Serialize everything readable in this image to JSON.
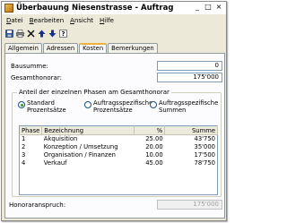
{
  "window": {
    "title": "Überbauung Niesenstrasse - Auftrag"
  },
  "titlebar_buttons": {
    "minimize": "_",
    "maximize": "□",
    "close": "×"
  },
  "menu": {
    "items": [
      {
        "underline": "D",
        "rest": "atei"
      },
      {
        "underline": "B",
        "rest": "earbeiten"
      },
      {
        "underline": "A",
        "rest": "nsicht"
      },
      {
        "underline": "H",
        "rest": "ilfe"
      }
    ]
  },
  "toolbar": {
    "icons": [
      "save-icon",
      "print-icon",
      "delete-icon",
      "arrow-up-icon",
      "arrow-down-icon",
      "help-icon"
    ]
  },
  "tabs": [
    "Allgemein",
    "Adressen",
    "Kosten",
    "Bemerkungen"
  ],
  "active_tab": "Kosten",
  "costs": {
    "bausumme_label": "Bausumme:",
    "bausumme_value": "0",
    "gesamthonorar_label": "Gesamthonorar:",
    "gesamthonorar_value": "175'000"
  },
  "group": {
    "title": "Anteil der einzelnen Phasen am Gesamthonorar",
    "options": [
      {
        "label": "Standard\nProzentsätze",
        "checked": true
      },
      {
        "label": "Auftragsspezifische\nProzentsätze",
        "checked": false
      },
      {
        "label": "Auftragsspezifische\nSummen",
        "checked": false
      }
    ]
  },
  "table": {
    "headers": [
      "Phase",
      "Bezeichnung",
      "%",
      "Summe"
    ],
    "rows": [
      [
        "1",
        "Akquisition",
        "25.00",
        "43'750"
      ],
      [
        "2",
        "Konzeption / Umsetzung",
        "20.00",
        "35'000"
      ],
      [
        "3",
        "Organisation / Finanzen",
        "10.00",
        "17'500"
      ],
      [
        "4",
        "Verkauf",
        "45.00",
        "78'750"
      ]
    ]
  },
  "footer": {
    "label": "Honoraranspruch:",
    "value": "175'000"
  }
}
